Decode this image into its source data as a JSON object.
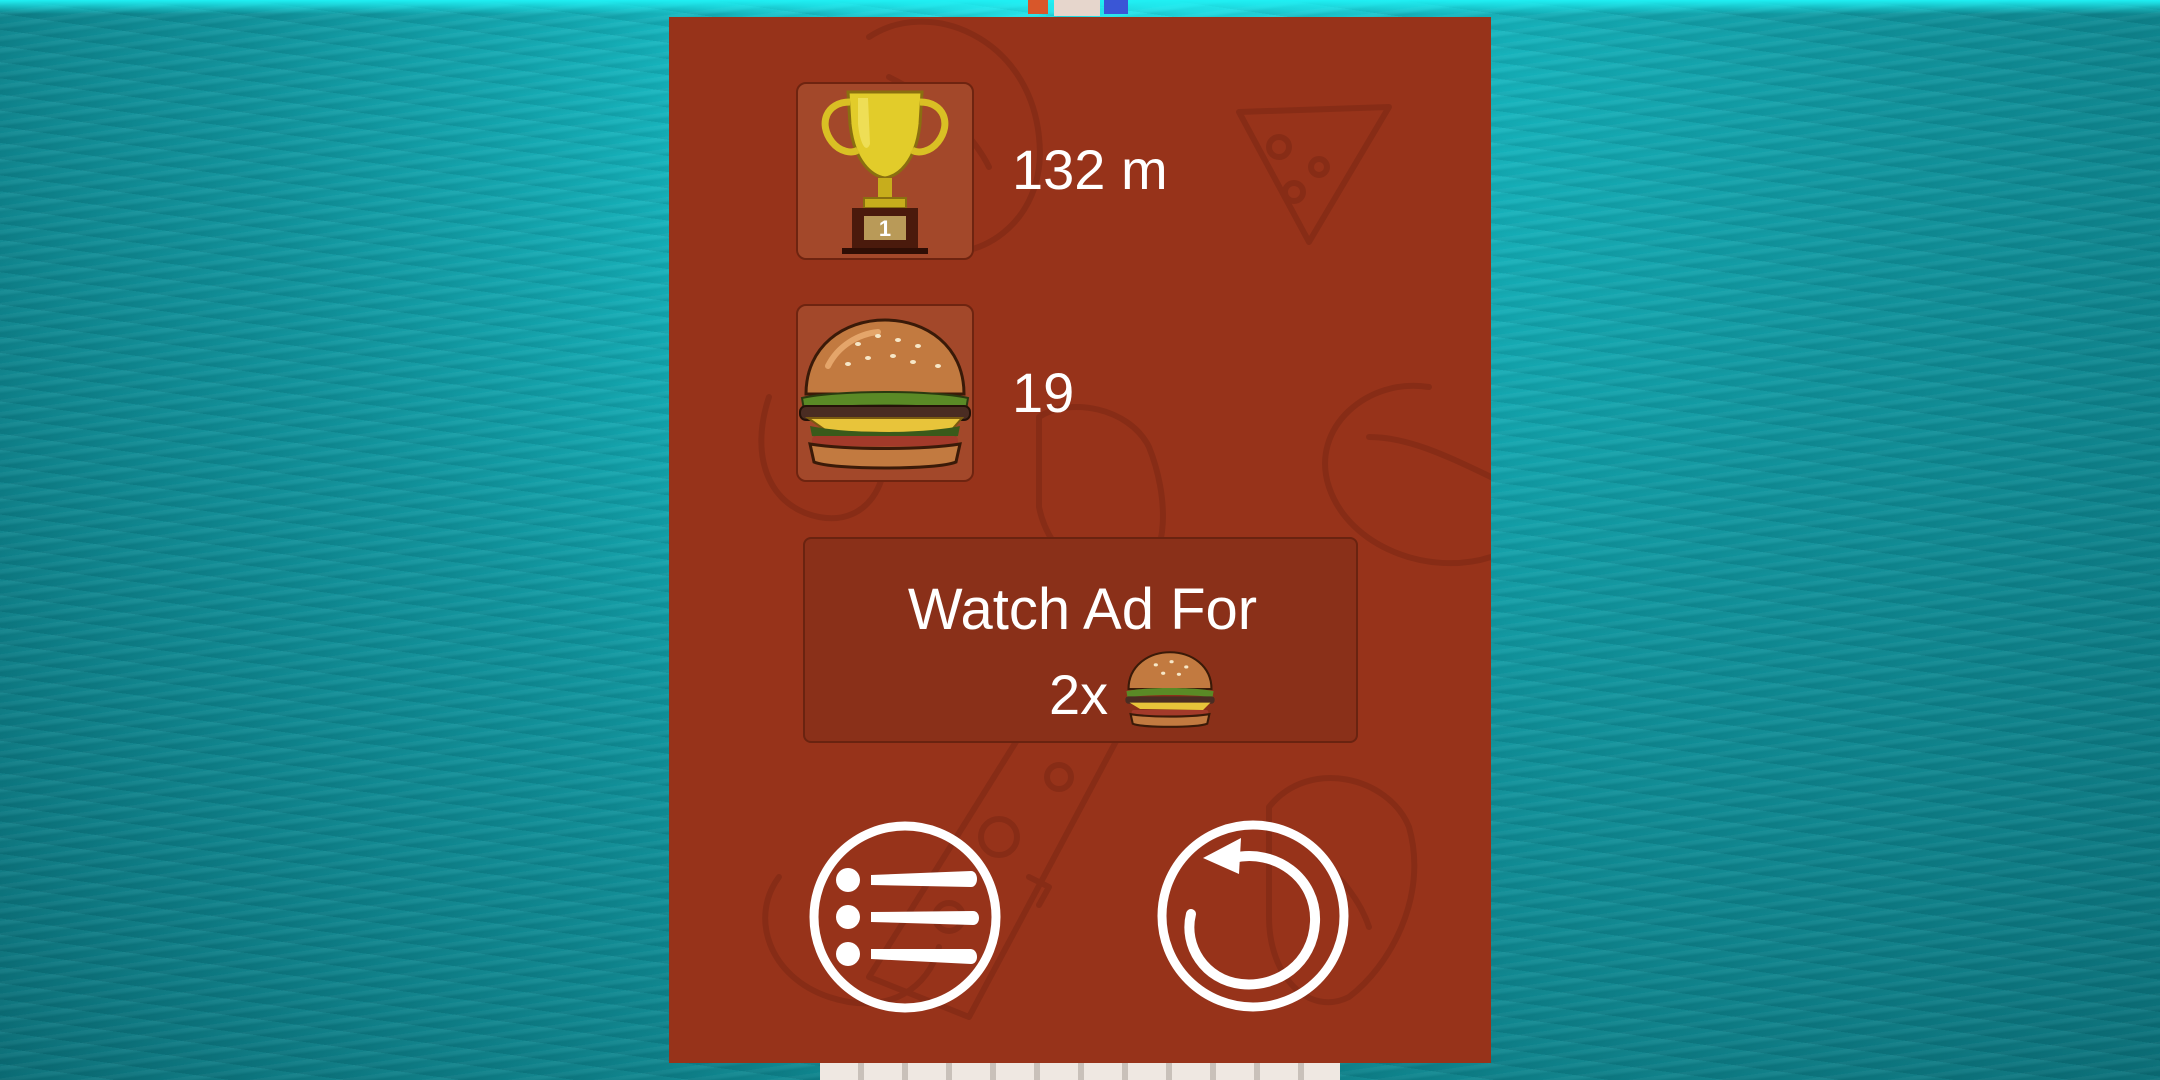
{
  "hud": {
    "best_distance": "132 m",
    "burgers_collected": "19"
  },
  "ad_offer": {
    "line1": "Watch Ad For",
    "multiplier": "2x",
    "reward_icon": "burger-icon"
  },
  "buttons": {
    "menu_icon": "list-menu-icon",
    "restart_icon": "restart-icon"
  },
  "icons": {
    "distance_icon": "trophy-icon",
    "burger_icon": "burger-icon",
    "trophy_rank": "1"
  },
  "colors": {
    "panel_background": "#97331a",
    "icon_box_background": "#a3482a",
    "ad_button_background": "#8a3019",
    "text": "#ffffff",
    "ocean": "#10939c"
  }
}
